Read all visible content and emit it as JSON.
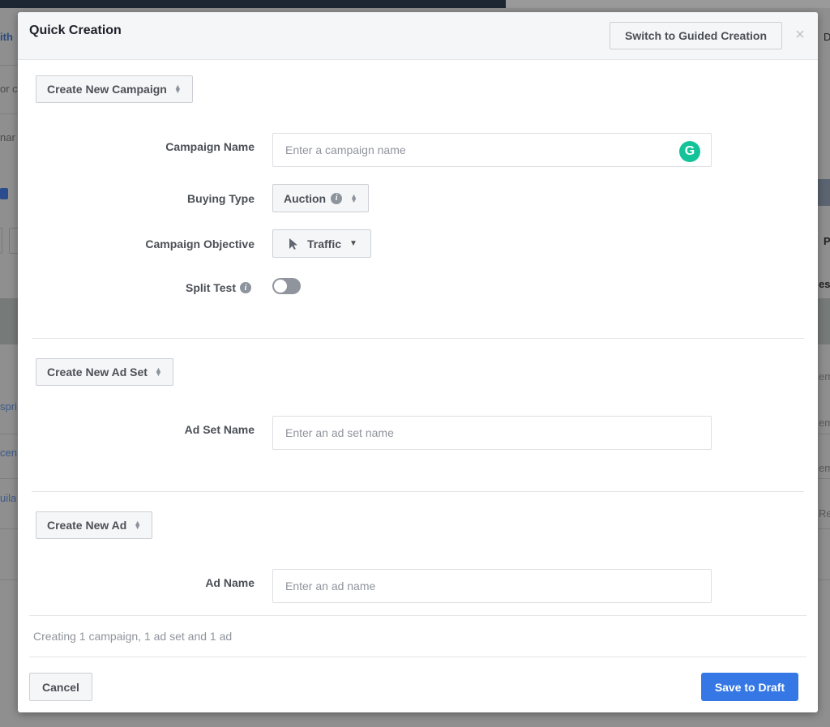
{
  "background": {
    "left_fragments": [
      "ith",
      "or c",
      "nar",
      "spri",
      "cen",
      "uila"
    ],
    "right_fragments": [
      "D",
      "P",
      "es",
      "em",
      "em",
      "em",
      "Re"
    ]
  },
  "modal": {
    "title": "Quick Creation",
    "switch_button": "Switch to Guided Creation",
    "close_icon": "×",
    "campaign": {
      "section_button": "Create New Campaign",
      "name_label": "Campaign Name",
      "name_placeholder": "Enter a campaign name",
      "name_value": "",
      "grammarly_icon": "G",
      "buying_type_label": "Buying Type",
      "buying_type_value": "Auction",
      "objective_label": "Campaign Objective",
      "objective_value": "Traffic",
      "split_test_label": "Split Test",
      "split_test_enabled": false
    },
    "ad_set": {
      "section_button": "Create New Ad Set",
      "name_label": "Ad Set Name",
      "name_placeholder": "Enter an ad set name",
      "name_value": ""
    },
    "ad": {
      "section_button": "Create New Ad",
      "name_label": "Ad Name",
      "name_placeholder": "Enter an ad name",
      "name_value": ""
    },
    "status_text": "Creating 1 campaign, 1 ad set and 1 ad",
    "cancel_button": "Cancel",
    "save_button": "Save to Draft",
    "colors": {
      "primary": "#3578e5",
      "grammarly": "#15c39a"
    }
  }
}
